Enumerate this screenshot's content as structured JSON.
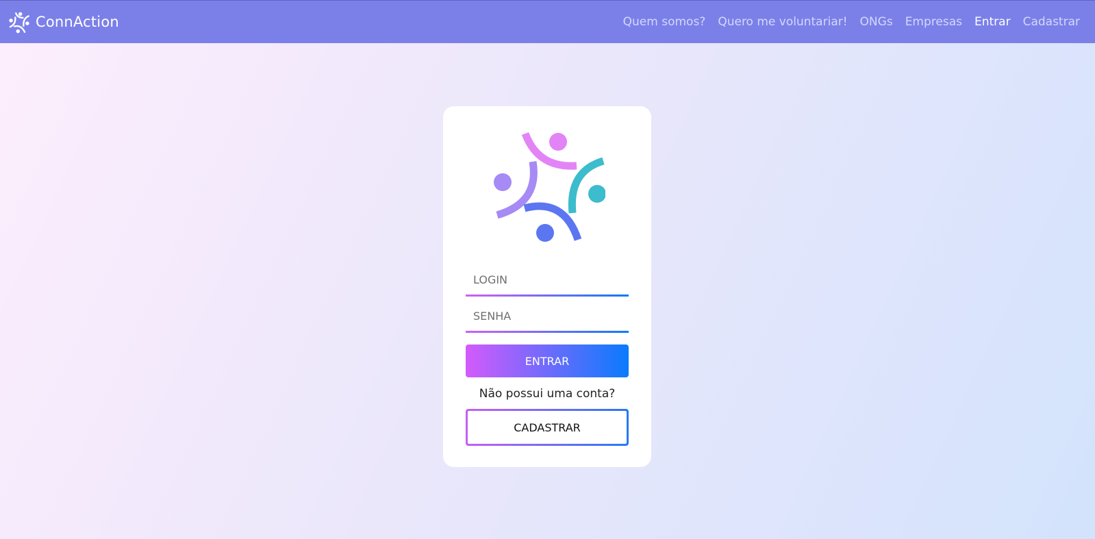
{
  "navbar": {
    "brand": "ConnAction",
    "brand_icon": "connaction-logo-icon",
    "links": [
      {
        "label": "Quem somos?"
      },
      {
        "label": "Quero me voluntariar!"
      },
      {
        "label": "ONGs"
      },
      {
        "label": "Empresas"
      },
      {
        "label": "Entrar",
        "active": true
      },
      {
        "label": "Cadastrar"
      }
    ],
    "color": "#7b80e9"
  },
  "login_card": {
    "logo_icon": "connaction-logo-icon",
    "login_placeholder": "LOGIN",
    "senha_placeholder": "SENHA",
    "entrar_label": "ENTRAR",
    "no_account_text": "Não possui uma conta?",
    "cadastrar_label": "CADASTRAR",
    "logo_colors": {
      "pink": "#e384f6",
      "purple": "#a68af6",
      "teal": "#3cbccc",
      "blue": "#5b76f0"
    },
    "gradient": [
      "#d35bfb",
      "#0a7bfd"
    ]
  }
}
